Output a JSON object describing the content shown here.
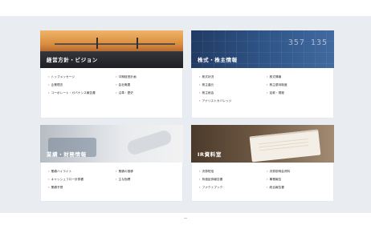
{
  "cards": {
    "philosophy": {
      "title": "経営方針・ビジョン",
      "links": [
        "トップメッセージ",
        "中期経営計画",
        "企業理念",
        "会社概要",
        "コーポレート・ガバナンス報告書",
        "沿革・歴史"
      ]
    },
    "stock": {
      "title": "株式・株主情報",
      "numbers": "357 135",
      "links": [
        "株式状況",
        "株式情報",
        "株主還元",
        "株主優待制度",
        "株主総会",
        "定款・規程",
        "アナリストカバレッジ"
      ]
    },
    "business": {
      "title": "業績・財務情報",
      "links": [
        "業績ハイライト",
        "業績の推移",
        "キャッシュフロー計算書",
        "主な指標",
        "業績予想"
      ]
    },
    "ir": {
      "title": "IR資料室",
      "links": [
        "決算短信",
        "決算説明会資料",
        "有価証券報告書",
        "事業報告",
        "ファクトブック",
        "統合報告書"
      ]
    }
  }
}
